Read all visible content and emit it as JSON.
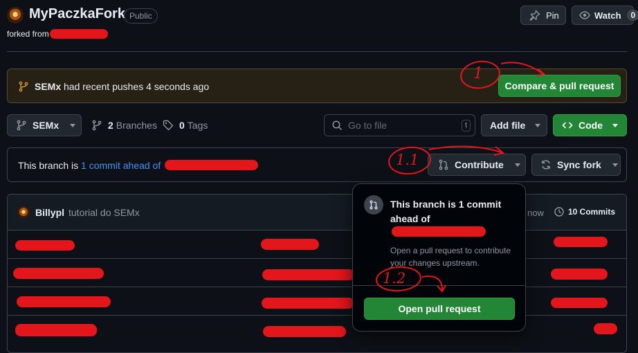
{
  "repo": {
    "name": "MyPaczkaFork",
    "visibility": "Public",
    "forked_from_label": "forked from"
  },
  "header_actions": {
    "pin_label": "Pin",
    "watch_label": "Watch",
    "watch_count": "0"
  },
  "push_banner": {
    "branch": "SEMx",
    "message": "had recent pushes 4 seconds ago",
    "button_label": "Compare & pull request"
  },
  "toolbar": {
    "branch_label": "SEMx",
    "branches_count": "2",
    "branches_label": "Branches",
    "tags_count": "0",
    "tags_label": "Tags",
    "search_placeholder": "Go to file",
    "search_shortcut": "t",
    "add_file_label": "Add file",
    "code_label": "Code"
  },
  "status_bar": {
    "prefix": "This branch is",
    "link": "1 commit ahead of",
    "contribute_label": "Contribute",
    "sync_label": "Sync fork"
  },
  "commit_bar": {
    "author": "Billypl",
    "message": "tutorial do SEMx",
    "time_fragment": "now",
    "commits_label": "10 Commits"
  },
  "popover": {
    "title": "This branch is 1 commit ahead of",
    "description": "Open a pull request to contribute your changes upstream.",
    "button_label": "Open pull request"
  },
  "annotations": {
    "a1": "1",
    "a2": "1.1",
    "a3": "1.2"
  },
  "colors": {
    "background": "#0d1117",
    "accent_green": "#238636",
    "link_blue": "#4493f8",
    "redaction_red": "#e3161b",
    "banner_border": "#574a24"
  }
}
